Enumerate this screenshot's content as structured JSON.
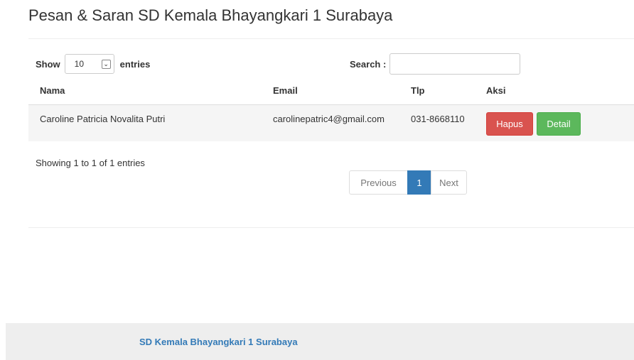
{
  "page": {
    "title": "Pesan & Saran SD Kemala Bhayangkari 1 Surabaya"
  },
  "table_controls": {
    "show_label": "Show",
    "entries_label": "entries",
    "page_length": "10",
    "chevron_glyph": "⌄",
    "search_label": "Search :",
    "search_value": "",
    "search_placeholder": ""
  },
  "table": {
    "columns": [
      "Nama",
      "Email",
      "Tlp",
      "Aksi"
    ],
    "rows": [
      {
        "nama": "Caroline Patricia Novalita Putri",
        "email": "carolinepatric4@gmail.com",
        "tlp": "031-8668110",
        "hapus_label": "Hapus",
        "detail_label": "Detail"
      }
    ]
  },
  "info": "Showing 1 to 1 of 1 entries",
  "pagination": {
    "previous_label": "Previous",
    "current_page": "1",
    "next_label": "Next"
  },
  "footer": {
    "text": "SD Kemala Bhayangkari 1 Surabaya"
  },
  "colors": {
    "primary": "#337ab7",
    "danger": "#d9534f",
    "success": "#5cb85c"
  }
}
